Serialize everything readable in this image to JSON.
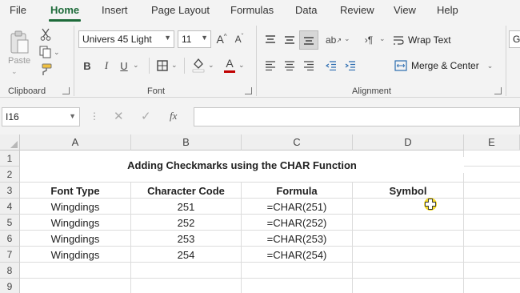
{
  "menu": {
    "items": [
      "File",
      "Home",
      "Insert",
      "Page Layout",
      "Formulas",
      "Data",
      "Review",
      "View",
      "Help"
    ]
  },
  "ribbon": {
    "clipboard": {
      "paste_label": "Paste",
      "group_label": "Clipboard"
    },
    "font": {
      "font_name": "Univers 45 Light",
      "font_size": "11",
      "group_label": "Font",
      "font_color": "#c00000"
    },
    "alignment": {
      "wrap_text": "Wrap Text",
      "merge_center": "Merge & Center",
      "group_label": "Alignment"
    },
    "number": {
      "format": "G"
    }
  },
  "formula_bar": {
    "name_box": "I16",
    "formula": ""
  },
  "sheet": {
    "columns": [
      "A",
      "B",
      "C",
      "D",
      "E"
    ],
    "rows": [
      "1",
      "2",
      "3",
      "4",
      "5",
      "6",
      "7",
      "8",
      "9"
    ],
    "title": "Adding Checkmarks using the CHAR Function",
    "headers": [
      "Font Type",
      "Character Code",
      "Formula",
      "Symbol"
    ],
    "data": [
      [
        "Wingdings",
        "251",
        "=CHAR(251)",
        ""
      ],
      [
        "Wingdings",
        "252",
        "=CHAR(252)",
        ""
      ],
      [
        "Wingdings",
        "253",
        "=CHAR(253)",
        ""
      ],
      [
        "Wingdings",
        "254",
        "=CHAR(254)",
        ""
      ]
    ]
  },
  "colors": {
    "accent": "#1e6b3a",
    "cursor": "#f2d200"
  }
}
